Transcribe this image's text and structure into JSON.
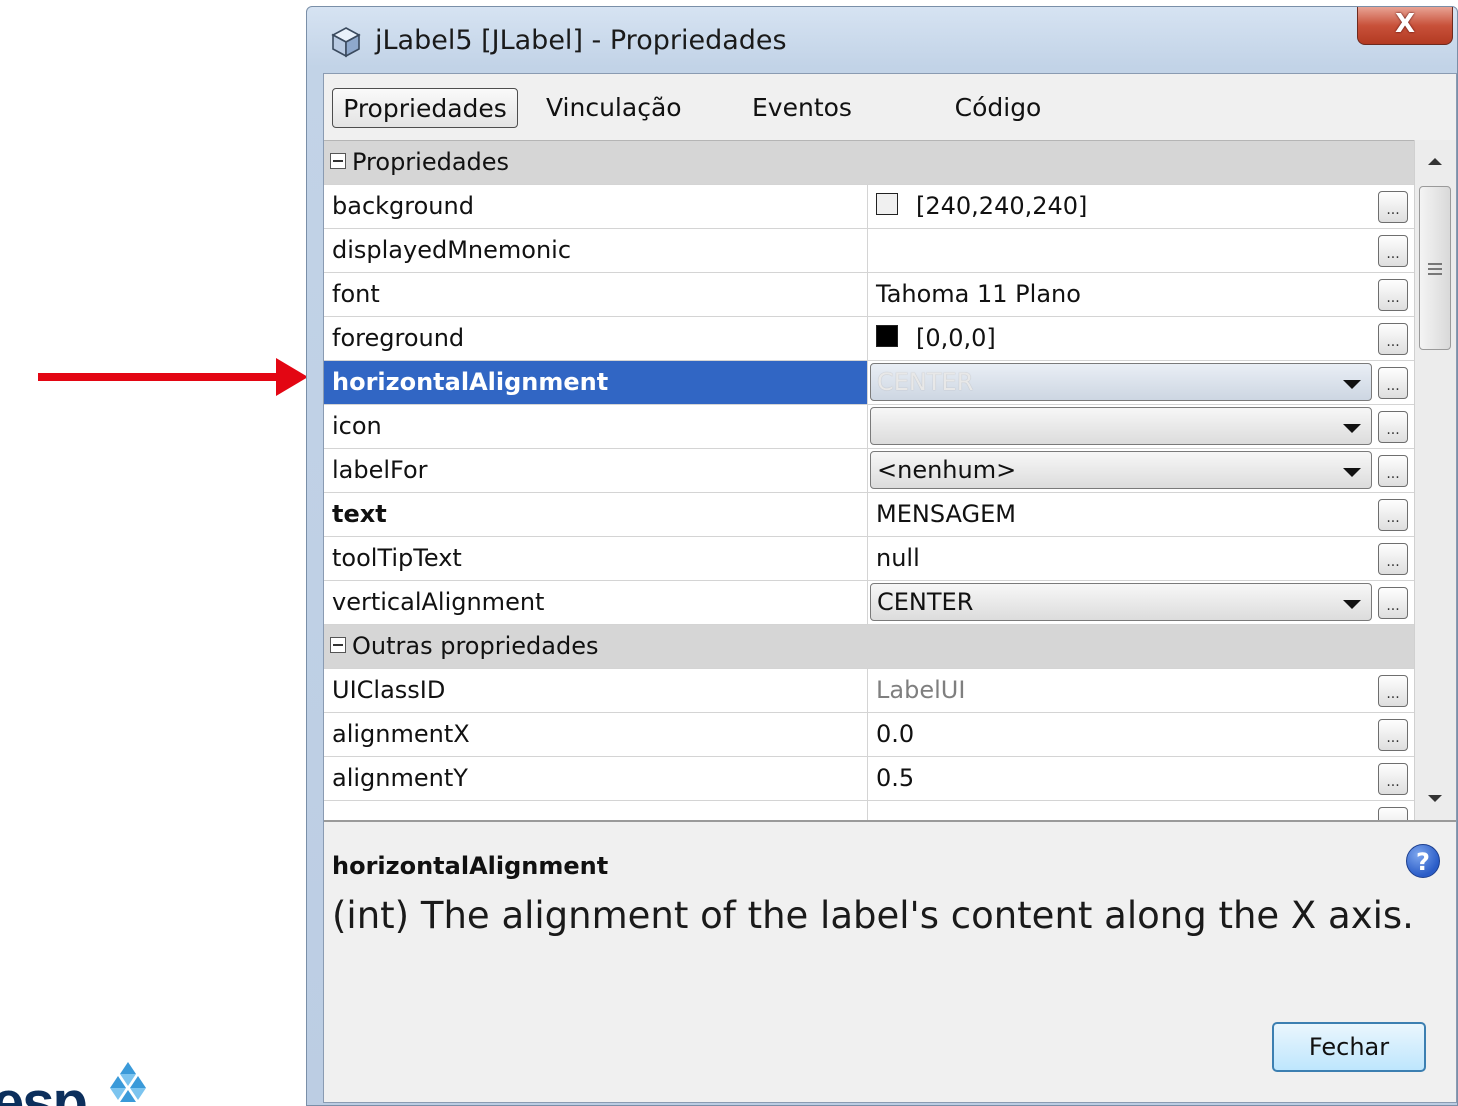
{
  "window": {
    "title": "jLabel5 [JLabel] - Propriedades",
    "close_label": "X"
  },
  "tabs": [
    {
      "label": "Propriedades",
      "active": true
    },
    {
      "label": "Vinculação",
      "active": false
    },
    {
      "label": "Eventos",
      "active": false
    },
    {
      "label": "Código",
      "active": false
    }
  ],
  "sections": {
    "props": "Propriedades",
    "other": "Outras propriedades"
  },
  "properties": [
    {
      "name": "background",
      "value": "[240,240,240]",
      "swatch": "#f0f0f0"
    },
    {
      "name": "displayedMnemonic",
      "value": ""
    },
    {
      "name": "font",
      "value": "Tahoma 11 Plano"
    },
    {
      "name": "foreground",
      "value": "[0,0,0]",
      "swatch": "#000000"
    },
    {
      "name": "horizontalAlignment",
      "value": "CENTER",
      "selected": true
    },
    {
      "name": "icon",
      "value": ""
    },
    {
      "name": "labelFor",
      "value": "<nenhum>"
    },
    {
      "name": "text",
      "value": "MENSAGEM"
    },
    {
      "name": "toolTipText",
      "value": "null"
    },
    {
      "name": "verticalAlignment",
      "value": "CENTER"
    }
  ],
  "other_properties": [
    {
      "name": "UIClassID",
      "value": "LabelUI"
    },
    {
      "name": "alignmentX",
      "value": "0.0"
    },
    {
      "name": "alignmentY",
      "value": "0.5"
    }
  ],
  "ellipsis": "...",
  "description": {
    "title": "horizontalAlignment",
    "text": "(int) The alignment of the label's content along the X axis."
  },
  "help_label": "?",
  "footer": {
    "close_button": "Fechar"
  },
  "logo": {
    "text": "esp"
  },
  "colors": {
    "selection": "#3166c4",
    "annotation_arrow": "#e30613"
  }
}
